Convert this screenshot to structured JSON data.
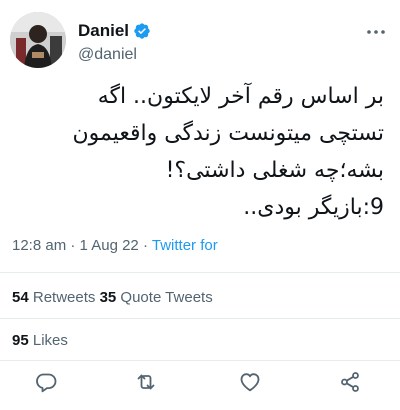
{
  "author": {
    "display_name": "Daniel",
    "handle": "@daniel",
    "verified": true
  },
  "tweet": {
    "lines": [
      "بر اساس رقم آخر لایکتون.. اگه",
      "تستچی میتونست زندگی واقعیمون",
      "بشه؛چه شغلی داشتی؟!",
      "9:بازیگر بودی.."
    ]
  },
  "meta": {
    "time": "12:8 am",
    "separator": "·",
    "date": "1 Aug 22",
    "source": "Twitter for"
  },
  "stats": {
    "retweets_count": "54",
    "retweets_label": "Retweets",
    "quote_count": "35",
    "quote_label": "Quote Tweets",
    "likes_count": "95",
    "likes_label": "Likes"
  },
  "colors": {
    "accent": "#1d9bf0",
    "text": "#0f1419",
    "secondary": "#536471",
    "divider": "#e6ebee"
  },
  "icons": {
    "verified": "verified-badge-icon",
    "more": "more-options-icon",
    "reply": "reply-icon",
    "retweet": "retweet-icon",
    "like": "heart-icon",
    "share": "share-icon"
  }
}
